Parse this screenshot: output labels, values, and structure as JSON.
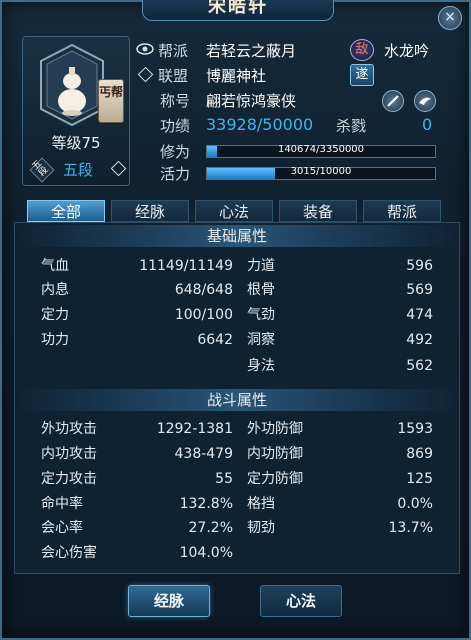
{
  "window": {
    "title": "宋皓轩",
    "close": "×"
  },
  "profile": {
    "level": "等级75",
    "rank": "五段",
    "rank_badge": "五段",
    "sect_badge": "丐帮"
  },
  "info": {
    "guild_label": "帮派",
    "guild_value": "若轻云之蔽月",
    "enemy_badge": "敌",
    "enemy_value": "水龙吟",
    "alliance_label": "联盟",
    "alliance_value": "博麗神社",
    "alliance_badge": "遂",
    "title_label": "称号",
    "title_value": "翩若惊鸿豪侠",
    "merit_label": "功绩",
    "merit_value": "33928/50000",
    "kill_label": "杀戮",
    "kill_value": "0",
    "cultivation_label": "修为",
    "cultivation_text": "140674/3350000",
    "cultivation_fraction": 0.042,
    "vitality_label": "活力",
    "vitality_text": "3015/10000",
    "vitality_fraction": 0.3
  },
  "tabs": [
    "全部",
    "经脉",
    "心法",
    "装备",
    "帮派"
  ],
  "basic": {
    "header": "基础属性",
    "left": [
      {
        "name": "气血",
        "value": "11149/11149"
      },
      {
        "name": "内息",
        "value": "648/648"
      },
      {
        "name": "定力",
        "value": "100/100"
      },
      {
        "name": "功力",
        "value": "6642"
      }
    ],
    "right": [
      {
        "name": "力道",
        "value": "596"
      },
      {
        "name": "根骨",
        "value": "569"
      },
      {
        "name": "气劲",
        "value": "474"
      },
      {
        "name": "洞察",
        "value": "492"
      },
      {
        "name": "身法",
        "value": "562"
      }
    ]
  },
  "combat": {
    "header": "战斗属性",
    "left": [
      {
        "name": "外功攻击",
        "value": "1292-1381"
      },
      {
        "name": "内功攻击",
        "value": "438-479"
      },
      {
        "name": "定力攻击",
        "value": "55"
      },
      {
        "name": "命中率",
        "value": "132.8%"
      },
      {
        "name": "会心率",
        "value": "27.2%"
      },
      {
        "name": "会心伤害",
        "value": "104.0%"
      }
    ],
    "right": [
      {
        "name": "外功防御",
        "value": "1593"
      },
      {
        "name": "内功防御",
        "value": "869"
      },
      {
        "name": "定力防御",
        "value": "125"
      },
      {
        "name": "格挡",
        "value": "0.0%"
      },
      {
        "name": "韧劲",
        "value": "13.7%"
      }
    ]
  },
  "buttons": {
    "meridian": "经脉",
    "mind": "心法"
  },
  "colors": {
    "accent": "#39b8f0",
    "bar": "#3fa6e8",
    "frame": "#3f6a88"
  }
}
